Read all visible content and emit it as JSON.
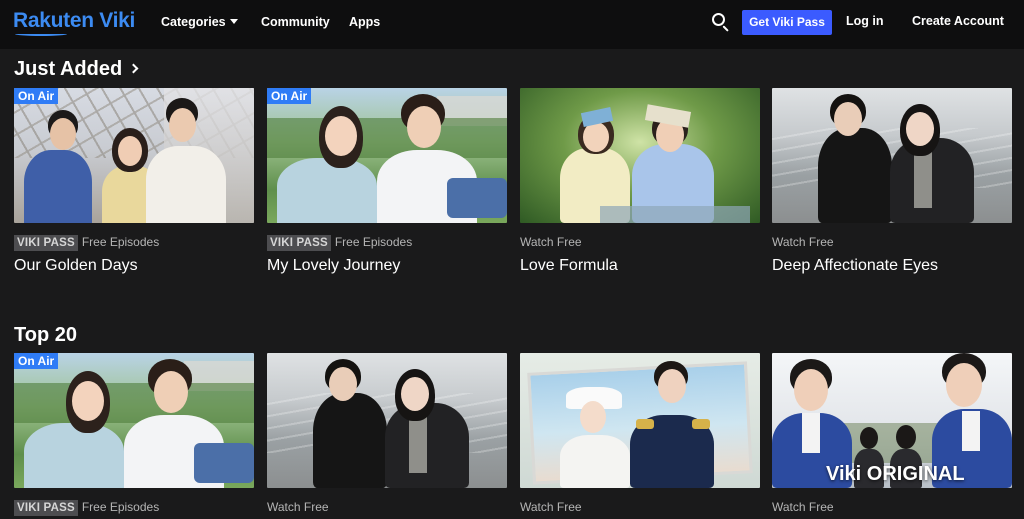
{
  "nav": {
    "logo": "Rakuten Viki",
    "categories": "Categories",
    "community": "Community",
    "apps": "Apps",
    "get_pass": "Get Viki Pass",
    "login": "Log in",
    "create_account": "Create Account"
  },
  "sections": [
    {
      "title": "Just Added",
      "cards": [
        {
          "badge": "On Air",
          "pass_label": "VIKI PASS",
          "availability": "Free Episodes",
          "title": "Our Golden Days"
        },
        {
          "badge": "On Air",
          "pass_label": "VIKI PASS",
          "availability": "Free Episodes",
          "title": "My Lovely Journey"
        },
        {
          "badge": "",
          "pass_label": "",
          "availability": "Watch Free",
          "title": "Love Formula"
        },
        {
          "badge": "",
          "pass_label": "",
          "availability": "Watch Free",
          "title": "Deep Affectionate Eyes"
        }
      ]
    },
    {
      "title": "Top 20",
      "cards": [
        {
          "badge": "On Air",
          "pass_label": "VIKI PASS",
          "availability": "Free Episodes",
          "title": ""
        },
        {
          "badge": "",
          "pass_label": "",
          "availability": "Watch Free",
          "title": ""
        },
        {
          "badge": "",
          "pass_label": "",
          "availability": "Watch Free",
          "title": ""
        },
        {
          "badge": "",
          "pass_label": "",
          "availability": "Watch Free",
          "title": "",
          "overlay": "Viki ORIGINAL"
        }
      ]
    }
  ],
  "colors": {
    "background": "#1a1a1b",
    "nav_background": "#0e0e0f",
    "accent": "#3b5bff",
    "badge": "#2f7cf6",
    "logo": "#3c8bf2"
  }
}
